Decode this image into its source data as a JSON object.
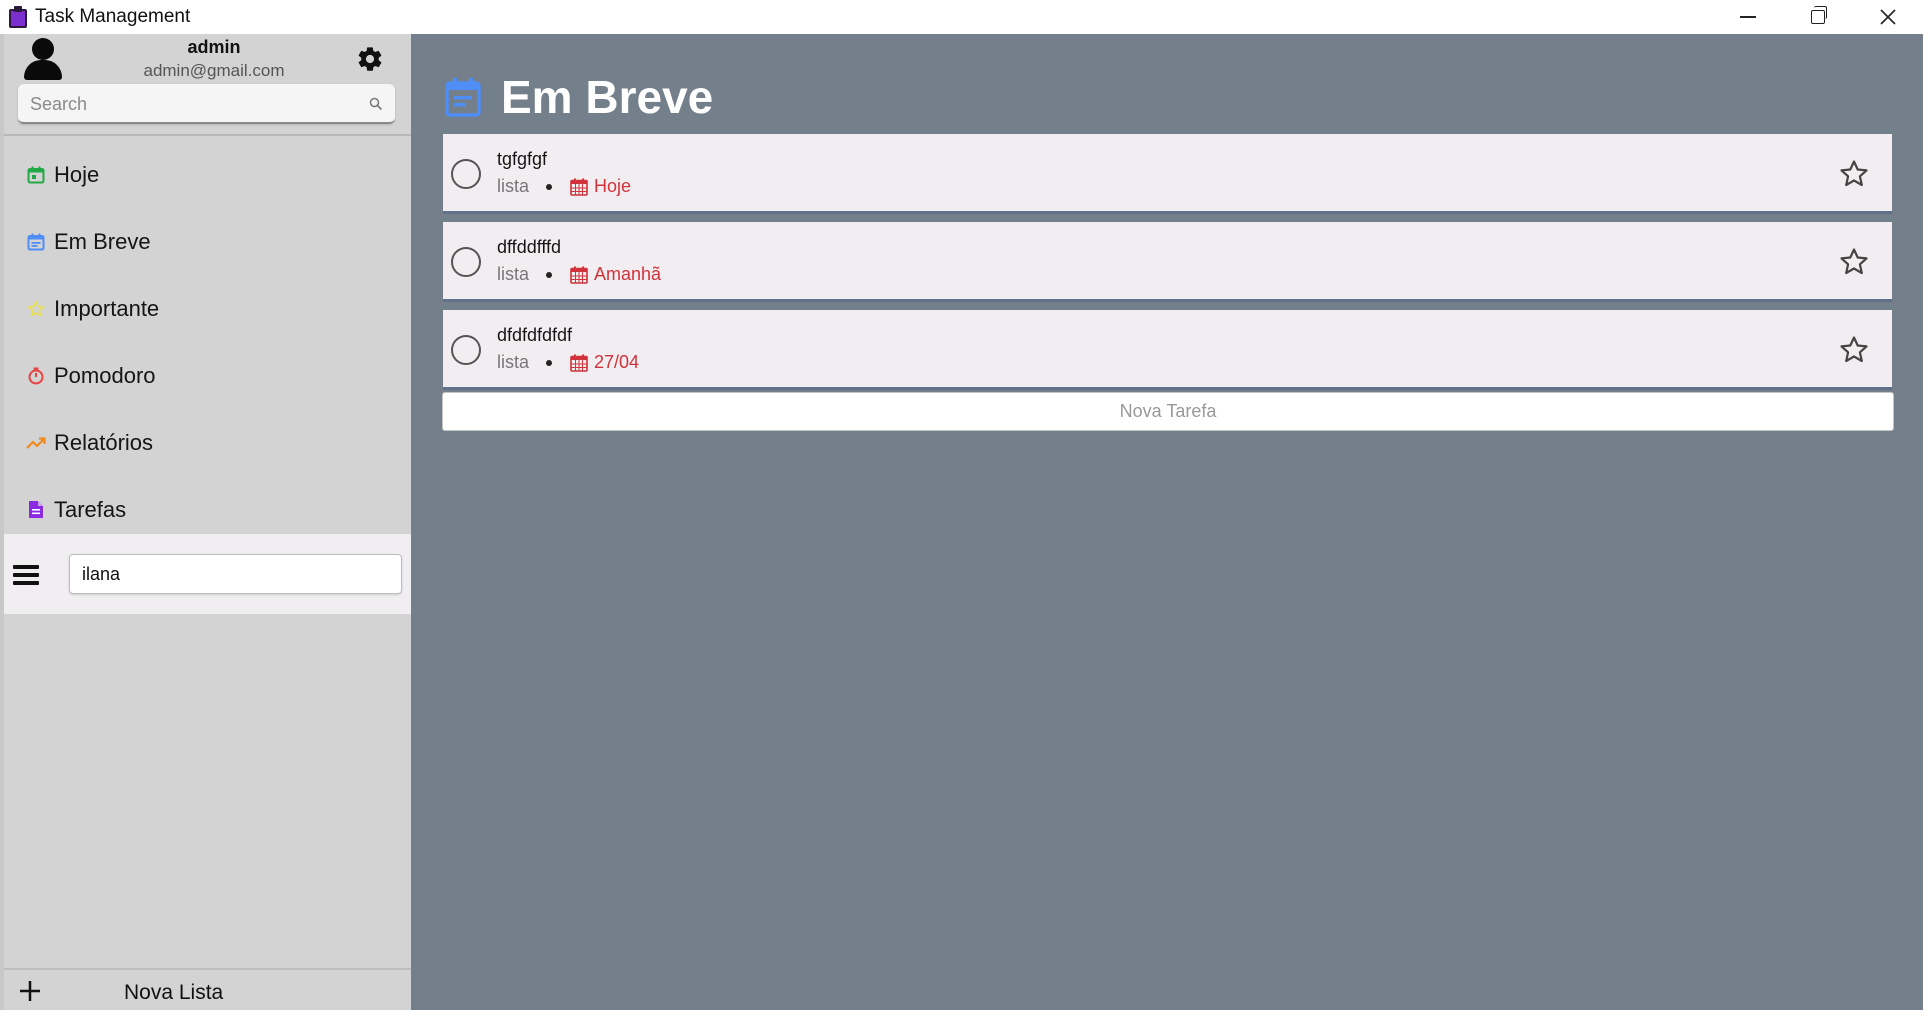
{
  "window": {
    "title": "Task Management"
  },
  "user": {
    "name": "admin",
    "email": "admin@gmail.com"
  },
  "search": {
    "placeholder": "Search"
  },
  "nav": {
    "items": [
      {
        "label": "Hoje",
        "icon": "calendar-today-icon",
        "color": "#22a845"
      },
      {
        "label": "Em Breve",
        "icon": "calendar-icon",
        "color": "#4f8ef7"
      },
      {
        "label": "Importante",
        "icon": "star-outline-icon",
        "color": "#e8e04a"
      },
      {
        "label": "Pomodoro",
        "icon": "timer-icon",
        "color": "#e84343"
      },
      {
        "label": "Relatórios",
        "icon": "trending-up-icon",
        "color": "#f08a1c"
      },
      {
        "label": "Tarefas",
        "icon": "document-icon",
        "color": "#8a2be2"
      }
    ]
  },
  "list_editor": {
    "value": "ilana"
  },
  "new_list": {
    "label": "Nova Lista"
  },
  "main": {
    "title": "Em Breve",
    "title_icon_color": "#4f8ef7",
    "tasks": [
      {
        "name": "tgfgfgf",
        "list": "lista",
        "due": "Hoje"
      },
      {
        "name": "dffddfffd",
        "list": "lista",
        "due": "Amanhã"
      },
      {
        "name": "dfdfdfdfdf",
        "list": "lista",
        "due": "27/04"
      }
    ],
    "new_task_label": "Nova Tarefa"
  },
  "colors": {
    "main_bg": "#737f8a",
    "sidebar_bg": "#d3d3d3",
    "due_red": "#d0333a"
  }
}
